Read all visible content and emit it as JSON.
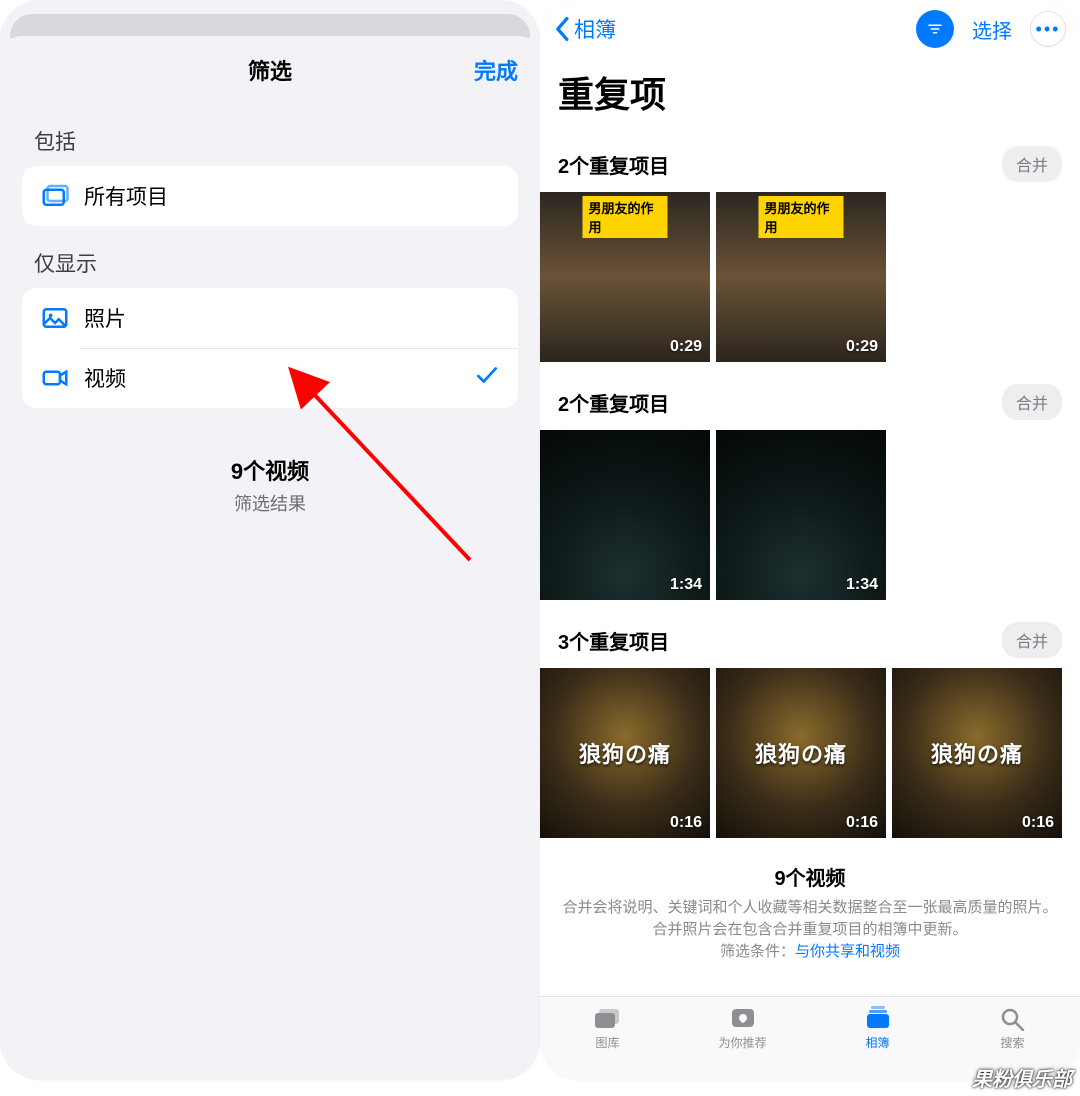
{
  "colors": {
    "accent": "#007aff"
  },
  "left": {
    "sheet_title": "筛选",
    "done": "完成",
    "section_include": "包括",
    "row_all_items": "所有项目",
    "section_only_show": "仅显示",
    "row_photos": "照片",
    "row_videos": "视频",
    "summary_count": "9个视频",
    "summary_sub": "筛选结果"
  },
  "right": {
    "back_label": "相簿",
    "select_label": "选择",
    "page_title": "重复项",
    "merge_label": "合并",
    "groups": [
      {
        "label": "2个重复项目",
        "items": [
          {
            "duration": "0:29",
            "banner": "男朋友的作用"
          },
          {
            "duration": "0:29",
            "banner": "男朋友的作用"
          }
        ]
      },
      {
        "label": "2个重复项目",
        "items": [
          {
            "duration": "1:34"
          },
          {
            "duration": "1:34"
          }
        ]
      },
      {
        "label": "3个重复项目",
        "items": [
          {
            "duration": "0:16",
            "overlay": "狼狗の痛"
          },
          {
            "duration": "0:16",
            "overlay": "狼狗の痛"
          },
          {
            "duration": "0:16",
            "overlay": "狼狗の痛"
          }
        ]
      }
    ],
    "footer_count": "9个视频",
    "footer_desc_a": "合并会将说明、关键词和个人收藏等相关数据整合至一张最高质量的照片。合并照片会在包含合并重复项目的相簿中更新。",
    "footer_filter_label": "筛选条件：",
    "footer_filter_link": "与你共享和视频",
    "tabs": {
      "library": "图库",
      "for_you": "为你推荐",
      "albums": "相簿",
      "search": "搜索"
    }
  },
  "watermark": "果粉俱乐部"
}
